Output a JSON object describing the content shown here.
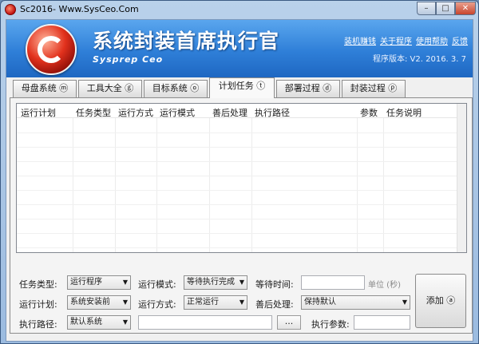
{
  "window": {
    "title": "Sc2016- Www.SysCeo.Com",
    "min": "–",
    "max": "□",
    "close": "✕"
  },
  "header": {
    "app_title": "系统封装首席执行官",
    "app_subtitle": "Sysprep  Ceo",
    "links": [
      "装机赚钱",
      "关于程序",
      "使用帮助",
      "反馈"
    ],
    "version": "程序版本: V2. 2016. 3. 7"
  },
  "tabs": [
    {
      "label": "母盘系统 ⓜ",
      "active": false
    },
    {
      "label": "工具大全 ⓖ",
      "active": false
    },
    {
      "label": "目标系统 ⓞ",
      "active": false
    },
    {
      "label": "计划任务 ⓣ",
      "active": true
    },
    {
      "label": "部署过程 ⓓ",
      "active": false
    },
    {
      "label": "封装过程 ⓟ",
      "active": false
    }
  ],
  "table": {
    "columns": [
      "运行计划",
      "任务类型",
      "运行方式",
      "运行模式",
      "善后处理",
      "执行路径",
      "参数",
      "任务说明"
    ],
    "rows": []
  },
  "form": {
    "task_type": {
      "label": "任务类型:",
      "value": "运行程序"
    },
    "run_mode": {
      "label": "运行模式:",
      "value": "等待执行完成"
    },
    "wait_time": {
      "label": "等待时间:",
      "value": "",
      "unit": "单位 (秒)"
    },
    "run_plan": {
      "label": "运行计划:",
      "value": "系统安装前"
    },
    "run_method": {
      "label": "运行方式:",
      "value": "正常运行"
    },
    "after_process": {
      "label": "善后处理:",
      "value": "保持默认"
    },
    "exec_path": {
      "label": "执行路径:",
      "value": "默认系统",
      "path_value": "",
      "browse": "..."
    },
    "exec_params": {
      "label": "执行参数:",
      "value": ""
    },
    "add_button": "添加 ⓐ"
  }
}
